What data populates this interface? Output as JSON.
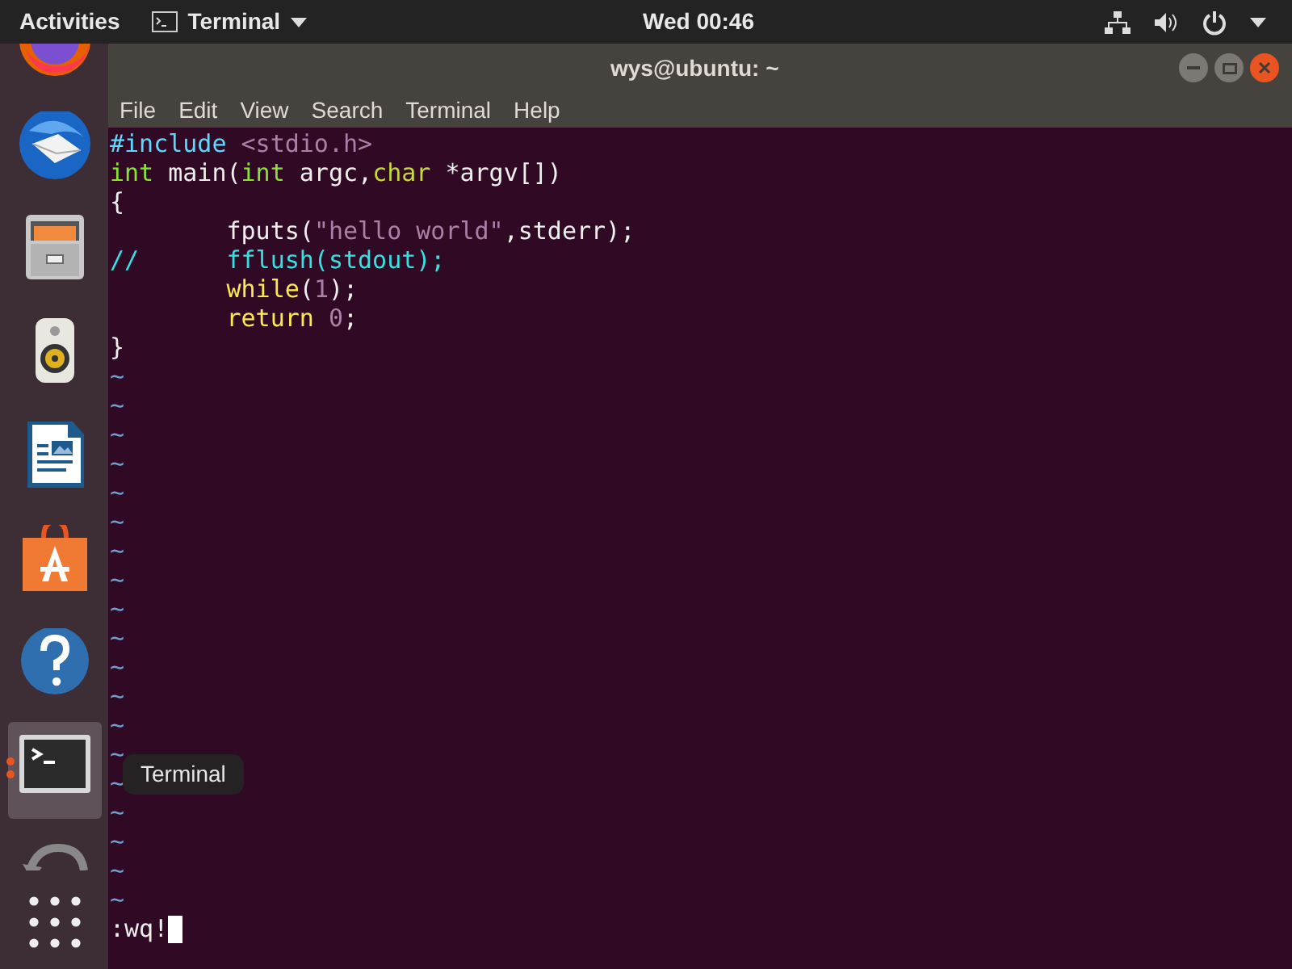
{
  "top_bar": {
    "activities": "Activities",
    "app_menu": "Terminal",
    "clock": "Wed 00:46"
  },
  "window": {
    "title": "wys@ubuntu: ~",
    "menu": [
      "File",
      "Edit",
      "View",
      "Search",
      "Terminal",
      "Help"
    ]
  },
  "dock": {
    "items": [
      {
        "kind": "firefox",
        "selected": false,
        "running": false
      },
      {
        "kind": "mail",
        "selected": false,
        "running": false
      },
      {
        "kind": "files",
        "selected": false,
        "running": false
      },
      {
        "kind": "music",
        "selected": false,
        "running": false
      },
      {
        "kind": "writer",
        "selected": false,
        "running": false
      },
      {
        "kind": "store",
        "selected": false,
        "running": false
      },
      {
        "kind": "help",
        "selected": false,
        "running": false
      },
      {
        "kind": "terminal",
        "selected": true,
        "running": true
      },
      {
        "kind": "updater",
        "selected": false,
        "running": false
      }
    ],
    "tooltip": "Terminal"
  },
  "editor": {
    "lines": [
      [
        {
          "kind": "preproc",
          "text": "#include "
        },
        {
          "kind": "constant",
          "text": "<stdio.h>"
        }
      ],
      [
        {
          "kind": "type",
          "text": "int"
        },
        {
          "kind": "plain",
          "text": " main("
        },
        {
          "kind": "type",
          "text": "int"
        },
        {
          "kind": "plain",
          "text": " argc,"
        },
        {
          "kind": "type2",
          "text": "char"
        },
        {
          "kind": "plain",
          "text": " *argv[])"
        }
      ],
      [
        {
          "kind": "plain",
          "text": "{"
        }
      ],
      [
        {
          "kind": "plain",
          "text": "\tfputs("
        },
        {
          "kind": "constant",
          "text": "\"hello world\""
        },
        {
          "kind": "plain",
          "text": ",stderr);"
        }
      ],
      [
        {
          "kind": "comment",
          "text": "//\tfflush(stdout);"
        }
      ],
      [
        {
          "kind": "keyword",
          "text": "\twhile"
        },
        {
          "kind": "plain",
          "text": "("
        },
        {
          "kind": "constant",
          "text": "1"
        },
        {
          "kind": "plain",
          "text": ");"
        }
      ],
      [
        {
          "kind": "keyword",
          "text": "\treturn"
        },
        {
          "kind": "constant",
          "text": " 0"
        },
        {
          "kind": "plain",
          "text": ";"
        }
      ],
      [
        {
          "kind": "plain",
          "text": "}"
        }
      ]
    ],
    "filler": [
      "~",
      "~",
      "~",
      "~",
      "~",
      "~",
      "~",
      "~",
      "~",
      "~",
      "~",
      "~",
      "~",
      "~",
      "~",
      "~",
      "~",
      "~",
      "~"
    ],
    "command": ":wq!"
  }
}
